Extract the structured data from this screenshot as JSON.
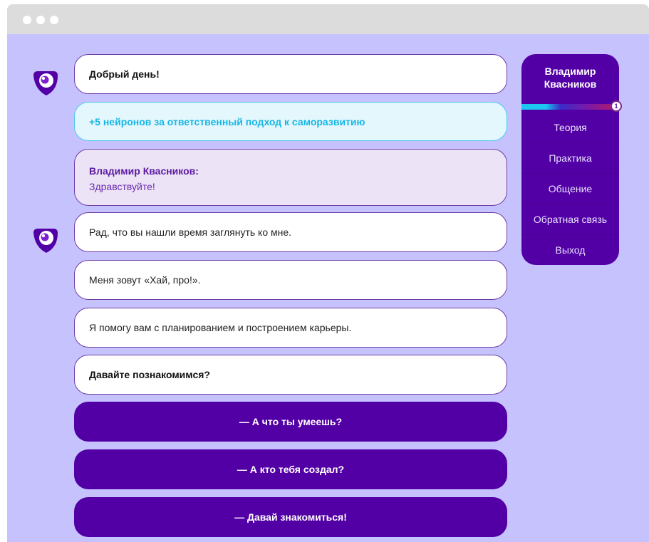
{
  "window": {
    "controls": [
      "dot",
      "dot",
      "dot"
    ]
  },
  "chat": {
    "greeting": "Добрый день!",
    "reward": "+5 нейронов за ответственный подход к саморазвитию",
    "user_message": {
      "name": "Владимир Квасников:",
      "text": "Здравствуйте!"
    },
    "bot_messages": [
      "Рад, что вы нашли время заглянуть ко мне.",
      "Меня зовут «Хай, про!».",
      "Я помогу вам с планированием и построением карьеры.",
      "Давайте познакомимся?"
    ],
    "choices": [
      "— А что ты умеешь?",
      "— А кто тебя создал?",
      "— Давай знакомиться!"
    ]
  },
  "sidebar": {
    "user_name": "Владимир Квасников",
    "level": "1",
    "progress": 0.26,
    "menu": [
      "Теория",
      "Практика",
      "Общение",
      "Обратная связь",
      "Выход"
    ]
  },
  "colors": {
    "background": "#c6c2fe",
    "accent": "#5200a5",
    "reward": "#16b6e6",
    "titlebar": "#dcdcdc"
  },
  "icons": {
    "avatar": "bot-eye-icon"
  }
}
